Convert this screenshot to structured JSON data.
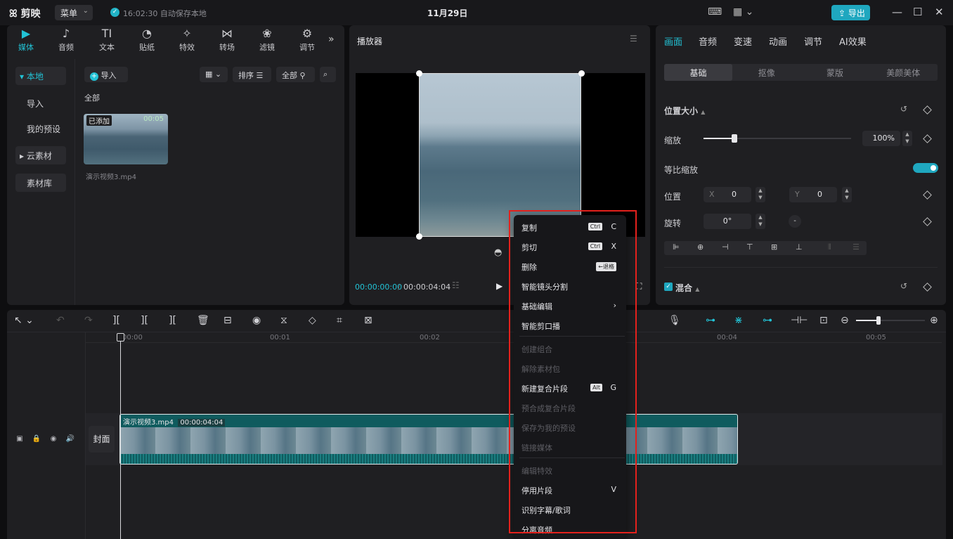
{
  "app": {
    "logo": "剪映",
    "menu": "菜单",
    "autosave": "16:02:30 自动保存本地",
    "date": "11月29日",
    "export": "导出"
  },
  "media_tabs": [
    {
      "icon": "▶",
      "label": "媒体"
    },
    {
      "icon": "♪",
      "label": "音频"
    },
    {
      "icon": "TI",
      "label": "文本"
    },
    {
      "icon": "◔",
      "label": "贴纸"
    },
    {
      "icon": "✧",
      "label": "特效"
    },
    {
      "icon": "⋈",
      "label": "转场"
    },
    {
      "icon": "❀",
      "label": "滤镜"
    },
    {
      "icon": "⚙",
      "label": "调节"
    }
  ],
  "media_side": {
    "local": "▾ 本地",
    "import": "导入",
    "preset": "我的预设",
    "cloud": "▸ 云素材",
    "library": "素材库"
  },
  "media_toolbar": {
    "import": "导入",
    "sort": "排序",
    "all": "全部"
  },
  "media": {
    "section": "全部",
    "clip_badge": "已添加",
    "clip_duration": "00:05",
    "clip_name": "演示视频3.mp4"
  },
  "player": {
    "title": "播放器",
    "current": "00:00:00:00",
    "total": "00:00:04:04"
  },
  "props": {
    "tabs": [
      "画面",
      "音频",
      "变速",
      "动画",
      "调节",
      "AI效果"
    ],
    "segments": [
      "基础",
      "抠像",
      "蒙版",
      "美颜美体"
    ],
    "pos_size": "位置大小",
    "scale": "缩放",
    "scale_val": "100%",
    "uniform": "等比缩放",
    "position": "位置",
    "x_label": "X",
    "x_val": "0",
    "y_label": "Y",
    "y_val": "0",
    "rotate": "旋转",
    "rotate_val": "0°",
    "blend": "混合",
    "scale_fraction": 0.3
  },
  "timeline": {
    "ruler": [
      "00:00",
      "00:01",
      "00:02",
      "00:04",
      "00:05"
    ],
    "clip_name": "演示视频3.mp4",
    "clip_dur": "00:00:04:04",
    "cover": "封面"
  },
  "context_menu": [
    {
      "label": "复制",
      "kbd": "Ctrl",
      "key": "C",
      "disabled": false
    },
    {
      "label": "剪切",
      "kbd": "Ctrl",
      "key": "X",
      "disabled": false
    },
    {
      "label": "删除",
      "kbd": "←退格",
      "key": "",
      "disabled": false
    },
    {
      "label": "智能镜头分割",
      "kbd": "",
      "key": "",
      "disabled": false
    },
    {
      "label": "基础编辑",
      "kbd": "",
      "key": "›",
      "disabled": false
    },
    {
      "label": "智能剪口播",
      "kbd": "",
      "key": "",
      "disabled": false
    },
    {
      "label": "创建组合",
      "kbd": "",
      "key": "",
      "disabled": true
    },
    {
      "label": "解除素材包",
      "kbd": "",
      "key": "",
      "disabled": true
    },
    {
      "label": "新建复合片段",
      "kbd": "Alt",
      "key": "G",
      "disabled": false
    },
    {
      "label": "预合成复合片段",
      "kbd": "",
      "key": "",
      "disabled": true
    },
    {
      "label": "保存为我的预设",
      "kbd": "",
      "key": "",
      "disabled": true
    },
    {
      "label": "链接媒体",
      "kbd": "",
      "key": "",
      "disabled": true
    },
    {
      "label": "编辑特效",
      "kbd": "",
      "key": "",
      "disabled": true
    },
    {
      "label": "停用片段",
      "kbd": "",
      "key": "V",
      "disabled": false
    },
    {
      "label": "识别字幕/歌词",
      "kbd": "",
      "key": "",
      "disabled": false
    },
    {
      "label": "分离音频",
      "kbd": "",
      "key": "",
      "disabled": false
    }
  ]
}
